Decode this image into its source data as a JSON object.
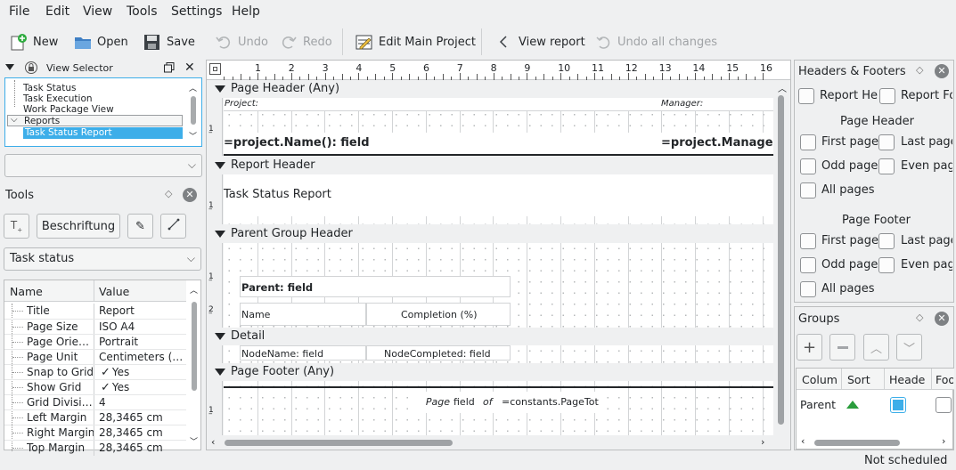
{
  "menu": [
    "File",
    "Edit",
    "View",
    "Tools",
    "Settings",
    "Help"
  ],
  "toolbar": {
    "new": "New",
    "open": "Open",
    "save": "Save",
    "undo": "Undo",
    "redo": "Redo",
    "edit_main_project": "Edit Main Project",
    "view_report": "View report",
    "undo_all": "Undo all changes"
  },
  "view_selector": {
    "title": "View Selector",
    "items": [
      "Task Status",
      "Task Execution",
      "Work Package View"
    ],
    "group": "Reports",
    "selected": "Task Status Report"
  },
  "tools": {
    "title": "Tools",
    "label_button": "Beschriftung",
    "combo": "Task status",
    "col_name": "Name",
    "col_value": "Value",
    "rows": [
      {
        "name": "Title",
        "value": "Report"
      },
      {
        "name": "Page Size",
        "value": "ISO A4"
      },
      {
        "name": "Page Orie…",
        "value": "Portrait"
      },
      {
        "name": "Page Unit",
        "value": "Centimeters (…"
      },
      {
        "name": "Snap to Grid",
        "value": "Yes"
      },
      {
        "name": "Show Grid",
        "value": "Yes"
      },
      {
        "name": "Grid Divisi…",
        "value": "4"
      },
      {
        "name": "Left Margin",
        "value": "28,3465 cm"
      },
      {
        "name": "Right Margin",
        "value": "28,3465 cm"
      },
      {
        "name": "Top Margin",
        "value": "28,3465 cm"
      }
    ]
  },
  "ruler_numbers": [
    "1",
    "2",
    "3",
    "4",
    "5",
    "6",
    "7",
    "8",
    "9",
    "10",
    "11",
    "12",
    "13",
    "14",
    "15",
    "16"
  ],
  "designer": {
    "page_header": "Page Header (Any)",
    "project_label": "Project:",
    "manager_label": "Manager:",
    "project_field": "=project.Name(): field",
    "manager_field": "=project.Manage",
    "report_header": "Report Header",
    "report_title": "Task Status Report",
    "parent_group_header": "Parent Group Header",
    "parent_field": "Parent: field",
    "col_name": "Name",
    "col_completion": "Completion (%)",
    "detail": "Detail",
    "node_name": "NodeName: field",
    "node_completed": "NodeCompleted: field",
    "page_footer": "Page Footer (Any)",
    "footer_page": "Page",
    "footer_field": "field",
    "footer_of": "of",
    "footer_total": "=constants.PageTot"
  },
  "headers_footers": {
    "title": "Headers & Footers",
    "report_header": "Report He",
    "report_footer": "Report Fo",
    "page_header_title": "Page Header",
    "page_footer_title": "Page Footer",
    "first_page": "First page",
    "last_page": "Last page",
    "odd_pages": "Odd page",
    "even_pages": "Even page",
    "all_pages": "All pages"
  },
  "groups": {
    "title": "Groups",
    "columns": [
      "Colum",
      "Sort",
      "Heade",
      "Foo"
    ],
    "row_name": "Parent"
  },
  "status": "Not scheduled",
  "colors": {
    "selection": "#3daee9",
    "accent": "#3daee9"
  }
}
